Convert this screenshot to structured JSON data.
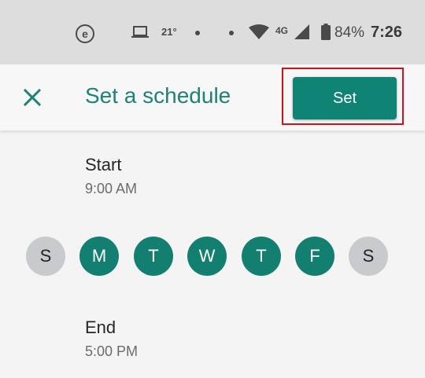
{
  "status_bar": {
    "notification_icon": "e-circle-icon",
    "temperature": "21°",
    "network": "4G",
    "battery_percent": "84%",
    "time": "7:26"
  },
  "app_bar": {
    "title": "Set a schedule",
    "close_icon": "close-icon",
    "set_label": "Set"
  },
  "schedule": {
    "start": {
      "label": "Start",
      "value": "9:00 AM"
    },
    "end": {
      "label": "End",
      "value": "5:00 PM"
    },
    "days": [
      {
        "label": "S",
        "selected": false
      },
      {
        "label": "M",
        "selected": true
      },
      {
        "label": "T",
        "selected": true
      },
      {
        "label": "W",
        "selected": true
      },
      {
        "label": "T",
        "selected": true
      },
      {
        "label": "F",
        "selected": true
      },
      {
        "label": "S",
        "selected": false
      }
    ]
  },
  "colors": {
    "accent": "#0f8374",
    "selected_day": "#137f71",
    "unselected_day": "#c9cacd",
    "highlight": "#d0101c"
  }
}
